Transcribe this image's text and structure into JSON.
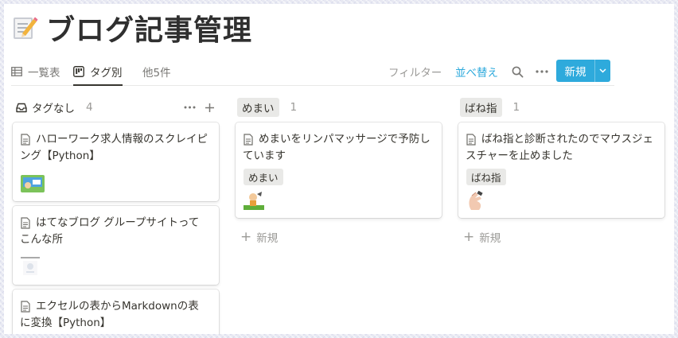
{
  "page": {
    "title": "ブログ記事管理",
    "icon": "memo-icon"
  },
  "views": {
    "table_label": "一覧表",
    "board_label": "タグ別",
    "more_label": "他5件"
  },
  "toolbar": {
    "filter_label": "フィルター",
    "sort_label": "並べ替え",
    "search_icon": "search-icon",
    "more_icon": "more-icon",
    "new_label": "新規"
  },
  "colors": {
    "accent": "#2eaadc",
    "tag_bg": "#e9e9e7",
    "text": "#37352f",
    "muted": "#9b9a97"
  },
  "columns": [
    {
      "label": "タグなし",
      "count": "4",
      "cards": [
        {
          "title": "ハローワーク求人情報のスクレイピング【Python】"
        },
        {
          "title": "はてなブログ グループサイトってこんな所"
        },
        {
          "title": "エクセルの表からMarkdownの表に変換【Python】"
        }
      ]
    },
    {
      "label": "めまい",
      "count": "1",
      "cards": [
        {
          "title": "めまいをリンパマッサージで予防しています",
          "tag": "めまい"
        }
      ],
      "new_label": "新規"
    },
    {
      "label": "ばね指",
      "count": "1",
      "cards": [
        {
          "title": "ばね指と診断されたのでマウスジェスチャーを止めました",
          "tag": "ばね指"
        }
      ],
      "new_label": "新規"
    }
  ]
}
